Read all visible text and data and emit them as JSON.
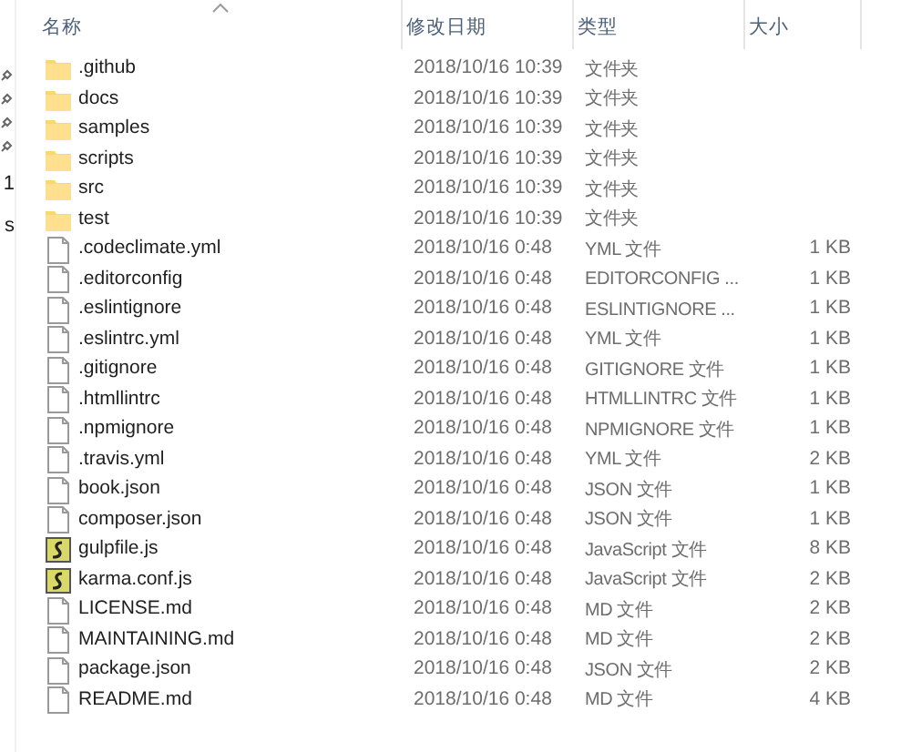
{
  "sidebar": {
    "items": [
      {
        "kind": "pin"
      },
      {
        "kind": "pin"
      },
      {
        "kind": "pin"
      },
      {
        "kind": "pin"
      },
      {
        "kind": "text",
        "label": "1"
      },
      {
        "kind": "text",
        "label": "s"
      }
    ]
  },
  "columns": [
    {
      "label": "名称",
      "sorted": true
    },
    {
      "label": "修改日期",
      "sorted": false
    },
    {
      "label": "类型",
      "sorted": false
    },
    {
      "label": "大小",
      "sorted": false
    }
  ],
  "rows": [
    {
      "kind": "folder",
      "name": ".github",
      "date": "2018/10/16 10:39",
      "type": "文件夹"
    },
    {
      "kind": "folder",
      "name": "docs",
      "date": "2018/10/16 10:39",
      "type": "文件夹"
    },
    {
      "kind": "folder",
      "name": "samples",
      "date": "2018/10/16 10:39",
      "type": "文件夹"
    },
    {
      "kind": "folder",
      "name": "scripts",
      "date": "2018/10/16 10:39",
      "type": "文件夹"
    },
    {
      "kind": "folder",
      "name": "src",
      "date": "2018/10/16 10:39",
      "type": "文件夹"
    },
    {
      "kind": "folder",
      "name": "test",
      "date": "2018/10/16 10:39",
      "type": "文件夹"
    },
    {
      "kind": "file",
      "name": ".codeclimate.yml",
      "date": "2018/10/16 0:48",
      "type": "YML 文件",
      "size": "1 KB"
    },
    {
      "kind": "file",
      "name": ".editorconfig",
      "date": "2018/10/16 0:48",
      "type": "EDITORCONFIG ...",
      "size": "1 KB"
    },
    {
      "kind": "file",
      "name": ".eslintignore",
      "date": "2018/10/16 0:48",
      "type": "ESLINTIGNORE ...",
      "size": "1 KB"
    },
    {
      "kind": "file",
      "name": ".eslintrc.yml",
      "date": "2018/10/16 0:48",
      "type": "YML 文件",
      "size": "1 KB"
    },
    {
      "kind": "file",
      "name": ".gitignore",
      "date": "2018/10/16 0:48",
      "type": "GITIGNORE 文件",
      "size": "1 KB"
    },
    {
      "kind": "file",
      "name": ".htmllintrc",
      "date": "2018/10/16 0:48",
      "type": "HTMLLINTRC 文件",
      "size": "1 KB"
    },
    {
      "kind": "file",
      "name": ".npmignore",
      "date": "2018/10/16 0:48",
      "type": "NPMIGNORE 文件",
      "size": "1 KB"
    },
    {
      "kind": "file",
      "name": ".travis.yml",
      "date": "2018/10/16 0:48",
      "type": "YML 文件",
      "size": "2 KB"
    },
    {
      "kind": "file",
      "name": "book.json",
      "date": "2018/10/16 0:48",
      "type": "JSON 文件",
      "size": "1 KB"
    },
    {
      "kind": "file",
      "name": "composer.json",
      "date": "2018/10/16 0:48",
      "type": "JSON 文件",
      "size": "1 KB"
    },
    {
      "kind": "script",
      "name": "gulpfile.js",
      "date": "2018/10/16 0:48",
      "type": "JavaScript 文件",
      "size": "8 KB"
    },
    {
      "kind": "script",
      "name": "karma.conf.js",
      "date": "2018/10/16 0:48",
      "type": "JavaScript 文件",
      "size": "2 KB"
    },
    {
      "kind": "file",
      "name": "LICENSE.md",
      "date": "2018/10/16 0:48",
      "type": "MD 文件",
      "size": "2 KB"
    },
    {
      "kind": "file",
      "name": "MAINTAINING.md",
      "date": "2018/10/16 0:48",
      "type": "MD 文件",
      "size": "2 KB"
    },
    {
      "kind": "file",
      "name": "package.json",
      "date": "2018/10/16 0:48",
      "type": "JSON 文件",
      "size": "2 KB"
    },
    {
      "kind": "file",
      "name": "README.md",
      "date": "2018/10/16 0:48",
      "type": "MD 文件",
      "size": "4 KB"
    }
  ]
}
